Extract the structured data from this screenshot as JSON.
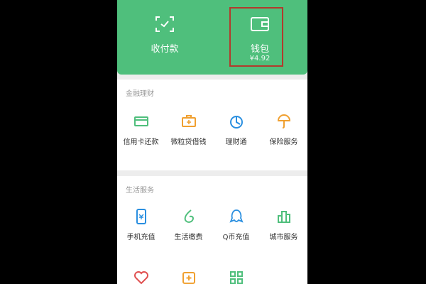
{
  "top": {
    "pay": {
      "label": "收付款",
      "icon": "scan-pay-icon"
    },
    "wallet": {
      "label": "钱包",
      "balance": "¥4.92",
      "icon": "wallet-icon"
    }
  },
  "finance": {
    "title": "金融理财",
    "items": [
      {
        "label": "信用卡还款",
        "icon": "credit-card-icon"
      },
      {
        "label": "微粒贷借钱",
        "icon": "loan-icon"
      },
      {
        "label": "理财通",
        "icon": "wealth-icon"
      },
      {
        "label": "保险服务",
        "icon": "insurance-icon"
      }
    ]
  },
  "life": {
    "title": "生活服务",
    "items": [
      {
        "label": "手机充值",
        "icon": "phone-topup-icon"
      },
      {
        "label": "生活缴费",
        "icon": "utility-icon"
      },
      {
        "label": "Q币充值",
        "icon": "qcoin-icon"
      },
      {
        "label": "城市服务",
        "icon": "city-icon"
      }
    ],
    "more_icons": [
      "heart-icon",
      "plus-box-icon",
      "grid-icon"
    ]
  },
  "colors": {
    "brand_green": "#4fbf7c",
    "highlight": "#b23a2c",
    "orange": "#f0a030",
    "blue": "#2a8fe0"
  }
}
